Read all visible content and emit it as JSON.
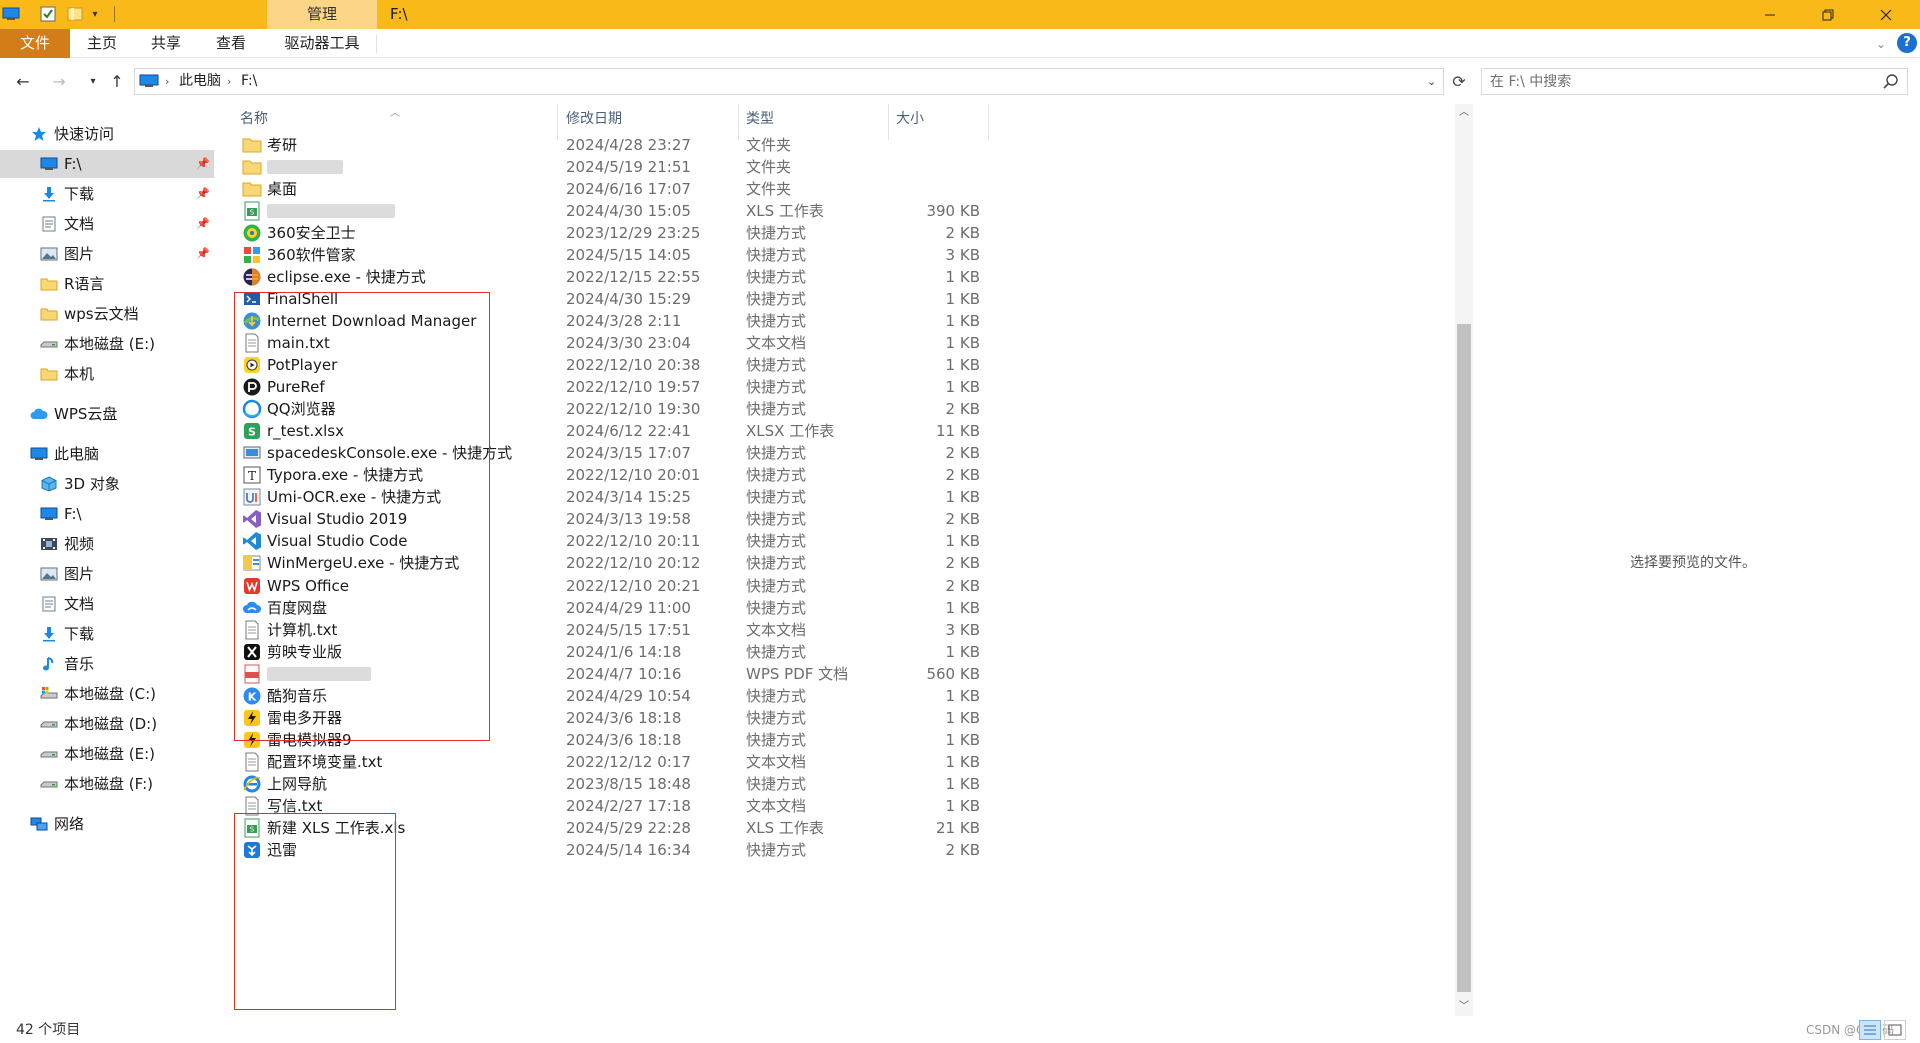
{
  "titlebar": {
    "context_tab": "管理",
    "path": "F:\\"
  },
  "ribbon": {
    "tabs": [
      "文件",
      "主页",
      "共享",
      "查看",
      "驱动器工具"
    ]
  },
  "address": {
    "crumbs": [
      "此电脑",
      "F:\\"
    ]
  },
  "search": {
    "placeholder": "在 F:\\ 中搜索"
  },
  "nav": {
    "quick_access": "快速访问",
    "quick_items": [
      "F:\\",
      "下载",
      "文档",
      "图片",
      "R语言",
      "wps云文档",
      "本地磁盘 (E:)",
      "本机"
    ],
    "wps": "WPS云盘",
    "this_pc": "此电脑",
    "pc_items": [
      "3D 对象",
      "F:\\",
      "视频",
      "图片",
      "文档",
      "下载",
      "音乐",
      "本地磁盘 (C:)",
      "本地磁盘 (D:)",
      "本地磁盘 (E:)",
      "本地磁盘 (F:)"
    ],
    "network": "网络"
  },
  "columns": {
    "name": "名称",
    "date": "修改日期",
    "type": "类型",
    "size": "大小"
  },
  "files": [
    {
      "name": "考研",
      "date": "2024/4/28 23:27",
      "type": "文件夹",
      "size": "",
      "icon": "folder-icon"
    },
    {
      "name": "",
      "date": "2024/5/19 21:51",
      "type": "文件夹",
      "size": "",
      "icon": "folder-icon"
    },
    {
      "name": "桌面",
      "date": "2024/6/16 17:07",
      "type": "文件夹",
      "size": "",
      "icon": "folder-icon"
    },
    {
      "name": "",
      "date": "2024/4/30 15:05",
      "type": "XLS 工作表",
      "size": "390 KB",
      "icon": "xls-icon"
    },
    {
      "name": "360安全卫士",
      "date": "2023/12/29 23:25",
      "type": "快捷方式",
      "size": "2 KB",
      "icon": "shield-360-icon"
    },
    {
      "name": "360软件管家",
      "date": "2024/5/15 14:05",
      "type": "快捷方式",
      "size": "3 KB",
      "icon": "software-360-icon"
    },
    {
      "name": "eclipse.exe - 快捷方式",
      "date": "2022/12/15 22:55",
      "type": "快捷方式",
      "size": "1 KB",
      "icon": "eclipse-icon"
    },
    {
      "name": "FinalShell",
      "date": "2024/4/30 15:29",
      "type": "快捷方式",
      "size": "1 KB",
      "icon": "finalshell-icon"
    },
    {
      "name": "Internet Download Manager",
      "date": "2024/3/28 2:11",
      "type": "快捷方式",
      "size": "1 KB",
      "icon": "idm-icon"
    },
    {
      "name": "main.txt",
      "date": "2024/3/30 23:04",
      "type": "文本文档",
      "size": "1 KB",
      "icon": "text-file-icon"
    },
    {
      "name": "PotPlayer",
      "date": "2022/12/10 20:38",
      "type": "快捷方式",
      "size": "1 KB",
      "icon": "potplayer-icon"
    },
    {
      "name": "PureRef",
      "date": "2022/12/10 19:57",
      "type": "快捷方式",
      "size": "1 KB",
      "icon": "pureref-icon"
    },
    {
      "name": "QQ浏览器",
      "date": "2022/12/10 19:30",
      "type": "快捷方式",
      "size": "2 KB",
      "icon": "qq-browser-icon"
    },
    {
      "name": "r_test.xlsx",
      "date": "2024/6/12 22:41",
      "type": "XLSX 工作表",
      "size": "11 KB",
      "icon": "xlsx-icon"
    },
    {
      "name": "spacedeskConsole.exe - 快捷方式",
      "date": "2024/3/15 17:07",
      "type": "快捷方式",
      "size": "2 KB",
      "icon": "spacedesk-icon"
    },
    {
      "name": "Typora.exe - 快捷方式",
      "date": "2022/12/10 20:01",
      "type": "快捷方式",
      "size": "2 KB",
      "icon": "typora-icon"
    },
    {
      "name": "Umi-OCR.exe - 快捷方式",
      "date": "2024/3/14 15:25",
      "type": "快捷方式",
      "size": "1 KB",
      "icon": "umi-ocr-icon"
    },
    {
      "name": "Visual Studio 2019",
      "date": "2024/3/13 19:58",
      "type": "快捷方式",
      "size": "2 KB",
      "icon": "visual-studio-icon"
    },
    {
      "name": "Visual Studio Code",
      "date": "2022/12/10 20:11",
      "type": "快捷方式",
      "size": "1 KB",
      "icon": "vscode-icon"
    },
    {
      "name": "WinMergeU.exe - 快捷方式",
      "date": "2022/12/10 20:12",
      "type": "快捷方式",
      "size": "2 KB",
      "icon": "winmerge-icon"
    },
    {
      "name": "WPS Office",
      "date": "2022/12/10 20:21",
      "type": "快捷方式",
      "size": "2 KB",
      "icon": "wps-office-icon"
    },
    {
      "name": "百度网盘",
      "date": "2024/4/29 11:00",
      "type": "快捷方式",
      "size": "1 KB",
      "icon": "baidu-netdisk-icon"
    },
    {
      "name": "计算机.txt",
      "date": "2024/5/15 17:51",
      "type": "文本文档",
      "size": "3 KB",
      "icon": "text-file-icon"
    },
    {
      "name": "剪映专业版",
      "date": "2024/1/6 14:18",
      "type": "快捷方式",
      "size": "1 KB",
      "icon": "jianying-icon"
    },
    {
      "name": "",
      "date": "2024/4/7 10:16",
      "type": "WPS PDF 文档",
      "size": "560 KB",
      "icon": "pdf-icon"
    },
    {
      "name": "酷狗音乐",
      "date": "2024/4/29 10:54",
      "type": "快捷方式",
      "size": "1 KB",
      "icon": "kugou-icon"
    },
    {
      "name": "雷电多开器",
      "date": "2024/3/6 18:18",
      "type": "快捷方式",
      "size": "1 KB",
      "icon": "leidian-multi-icon"
    },
    {
      "name": "雷电模拟器9",
      "date": "2024/3/6 18:18",
      "type": "快捷方式",
      "size": "1 KB",
      "icon": "leidian-emulator-icon"
    },
    {
      "name": "配置环境变量.txt",
      "date": "2022/12/12 0:17",
      "type": "文本文档",
      "size": "1 KB",
      "icon": "text-file-icon"
    },
    {
      "name": "上网导航",
      "date": "2023/8/15 18:48",
      "type": "快捷方式",
      "size": "1 KB",
      "icon": "ie-icon"
    },
    {
      "name": "写信.txt",
      "date": "2024/2/27 17:18",
      "type": "文本文档",
      "size": "1 KB",
      "icon": "text-file-icon"
    },
    {
      "name": "新建 XLS 工作表.xls",
      "date": "2024/5/29 22:28",
      "type": "XLS 工作表",
      "size": "21 KB",
      "icon": "xls-icon"
    },
    {
      "name": "迅雷",
      "date": "2024/5/14 16:34",
      "type": "快捷方式",
      "size": "2 KB",
      "icon": "xunlei-icon"
    }
  ],
  "preview": {
    "message": "选择要预览的文件。"
  },
  "status": {
    "count": "42 个项目",
    "watermark": "CSDN @Q-由码"
  },
  "colors": {
    "title_bar": "#f9b918",
    "file_tab": "#d27c1a",
    "highlight_box": "#e02d2d"
  }
}
